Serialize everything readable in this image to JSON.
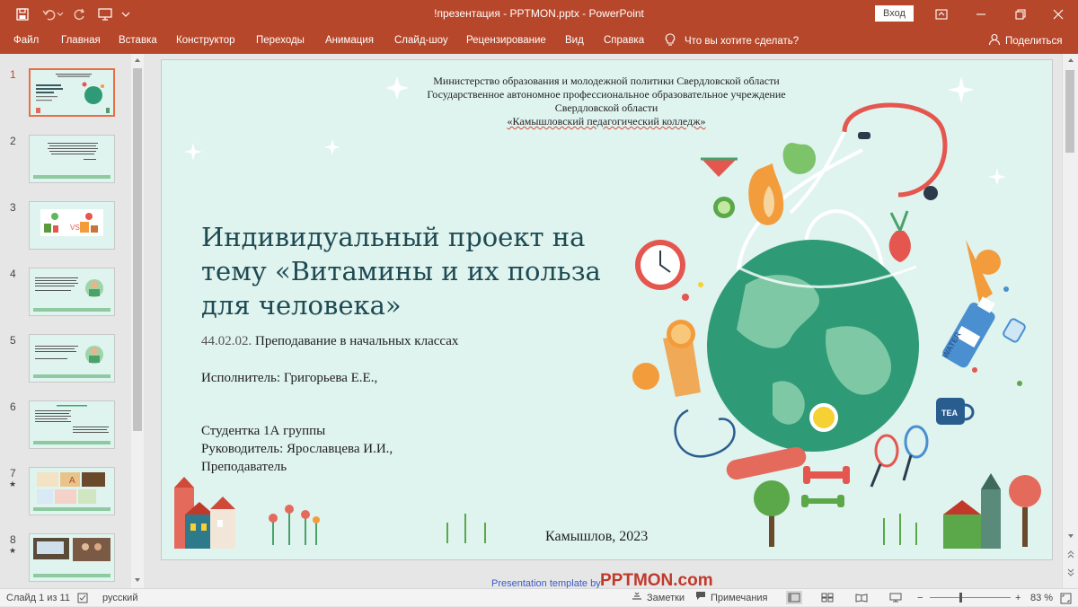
{
  "window": {
    "title": "!презентация - PPTMON.pptx  -  PowerPoint",
    "signin_label": "Вход"
  },
  "ribbon": {
    "tabs": [
      "Файл",
      "Главная",
      "Вставка",
      "Конструктор",
      "Переходы",
      "Анимация",
      "Слайд-шоу",
      "Рецензирование",
      "Вид",
      "Справка"
    ],
    "tell_me": "Что вы хотите сделать?",
    "share": "Поделиться"
  },
  "thumbnails": {
    "numbers": [
      "1",
      "2",
      "3",
      "4",
      "5",
      "6",
      "7",
      "8"
    ],
    "star": "★",
    "selected": "1"
  },
  "slide": {
    "ministry": [
      "Министерство образования и молодежной политики Свердловской области",
      "Государственное автономное профессиональное образовательное учреждение",
      "Свердловской области",
      "«Камышловский педагогический колледж»"
    ],
    "title_lines": [
      "Индивидуальный проект на",
      "тему «Витамины и их польза",
      "для человека»"
    ],
    "spec_code": "44.02.02.",
    "spec_name": "Преподавание в начальных классах",
    "executor": "Исполнитель: Григорьева Е.Е.,",
    "student": "Студентка 1А группы",
    "supervisor": "Руководитель: Ярославцева И.И.,",
    "supervisor_role": "Преподаватель",
    "place_year": "Камышлов, 2023",
    "artwork_labels": [
      "WATER",
      "TEA"
    ],
    "footer_link": "Presentation template by",
    "footer_brand": "PPTMON.com"
  },
  "status": {
    "slide_counter": "Слайд 1 из 11",
    "language": "русский",
    "notes": "Заметки",
    "comments": "Примечания",
    "zoom_minus": "−",
    "zoom_plus": "+",
    "zoom": "83 %"
  },
  "colors": {
    "accent": "#b7472a",
    "slide_bg": "#dff3ef",
    "title_text": "#1e4a52",
    "globe": "#2f9a76",
    "coral": "#e5564f",
    "selected_thumb": "#e96e45"
  }
}
